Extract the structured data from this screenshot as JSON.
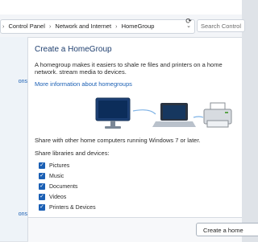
{
  "address_bar": {
    "breadcrumb": [
      {
        "label": "Control Panel"
      },
      {
        "label": "Network and Internet"
      },
      {
        "label": "HomeGroup"
      }
    ],
    "search_placeholder": "Search Control"
  },
  "nav": {
    "items": [
      {
        "label": "ons"
      },
      {
        "label": "ons"
      }
    ]
  },
  "main": {
    "title": "Create a HomeGroup",
    "description": "A homegroup makes it easiers to shale re files and printers on a home network. stream media to devices.",
    "more_info_link": "More information about homegroups",
    "share_text": "Share with other home computers running Windows 7 or later.",
    "share_label": "Share libraries and devices:",
    "libraries": [
      {
        "label": "Pictures",
        "checked": true
      },
      {
        "label": "Music",
        "checked": true
      },
      {
        "label": "Documents",
        "checked": true
      },
      {
        "label": "Videos",
        "checked": true
      },
      {
        "label": "Printers & Devices",
        "checked": true
      }
    ]
  },
  "footer": {
    "create_button": "Create a home"
  },
  "icons": {
    "refresh": "refresh-icon",
    "dropdown": "chevron-down-icon",
    "check": "check-icon",
    "monitor": "desktop-computer-icon",
    "laptop": "laptop-icon",
    "printer": "printer-icon"
  },
  "colors": {
    "link": "#1a5fb4",
    "checkbox": "#1a5fb4",
    "title": "#1f3f6f"
  }
}
